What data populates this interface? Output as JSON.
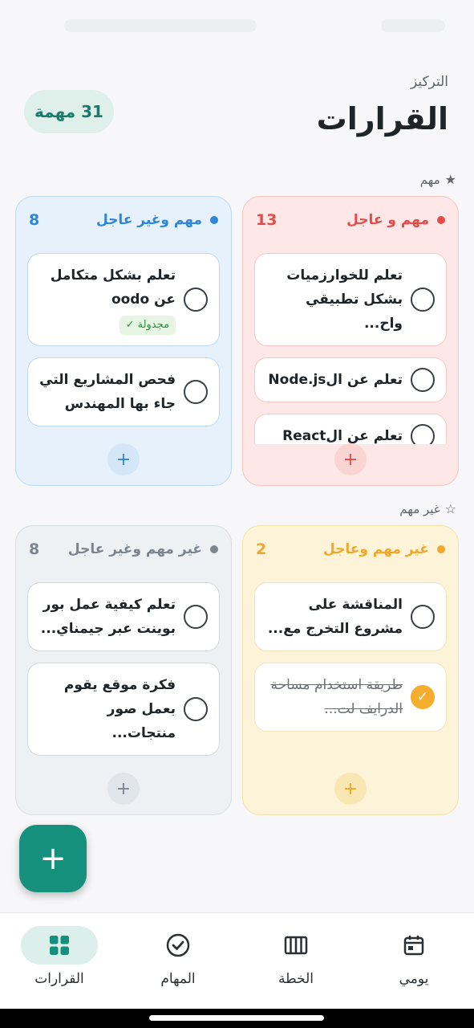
{
  "header": {
    "subtitle": "التركيز",
    "title": "القرارات",
    "task_count": "31 مهمة"
  },
  "sections": {
    "important": "مهم",
    "not_important": "غير مهم"
  },
  "colors": {
    "accent": "#14907c",
    "urgent_important": "#e44b4b",
    "important_not_urgent": "#2f86d6",
    "urgent_not_important": "#f0a72a",
    "neither": "#7a8590"
  },
  "quadrants": {
    "q1": {
      "name": "مهم و عاجل",
      "count": "13",
      "tasks": [
        {
          "text": "تعلم للخوارزميات بشكل تطبيقي واح...",
          "done": false
        },
        {
          "text": "تعلم عن الNode.js",
          "done": false
        },
        {
          "text": "تعلم عن الReact",
          "done": false
        }
      ]
    },
    "q2": {
      "name": "مهم وغير عاجل",
      "count": "8",
      "tasks": [
        {
          "text": "تعلم بشكل متكامل عن oodo",
          "done": false,
          "badge": "مجدولة ✓"
        },
        {
          "text": "فحص المشاريع التي جاء بها المهندس",
          "done": false
        }
      ]
    },
    "q3": {
      "name": "غير مهم وعاجل",
      "count": "2",
      "tasks": [
        {
          "text": "المناقشة على مشروع التخرج مع...",
          "done": false
        },
        {
          "text": "طريقة استخدام مساحة الدرايف لت...",
          "done": true
        }
      ]
    },
    "q4": {
      "name": "غير مهم وغير عاجل",
      "count": "8",
      "tasks": [
        {
          "text": "تعلم كيفية عمل بور بوينت عبر جيمناي...",
          "done": false
        },
        {
          "text": "فكرة موقع يقوم بعمل صور منتجات...",
          "done": false
        }
      ]
    }
  },
  "fab": {
    "label": "+"
  },
  "nav": {
    "daily": "يومي",
    "plan": "الخطة",
    "tasks": "المهام",
    "decisions": "القرارات"
  }
}
